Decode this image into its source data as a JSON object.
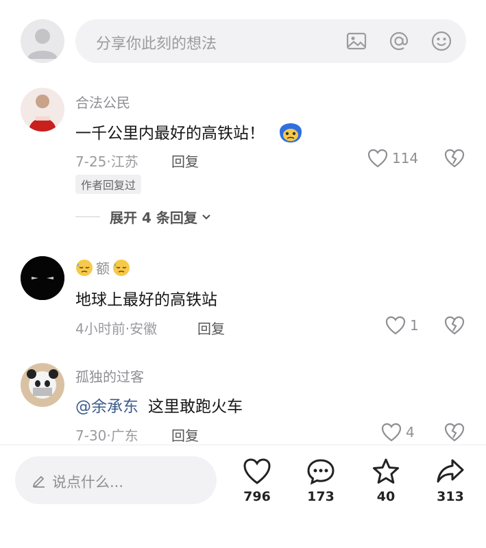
{
  "composer": {
    "placeholder": "分享你此刻的想法"
  },
  "comments": [
    {
      "name": "合法公民",
      "text": "一千公里内最好的高铁站！",
      "date_location": "7-25·江苏",
      "reply_label": "回复",
      "likes": "114",
      "author_badge": "作者回复过",
      "expand_label": "展开 4 条回复"
    },
    {
      "name": "额",
      "text": "地球上最好的高铁站",
      "date_location": "4小时前·安徽",
      "reply_label": "回复",
      "likes": "1"
    },
    {
      "name": "孤独的过客",
      "mention": "@余承东",
      "text": "这里敢跑火车",
      "date_location": "7-30·广东",
      "reply_label": "回复",
      "likes": "4"
    }
  ],
  "bottom_bar": {
    "input_placeholder": "说点什么...",
    "like_count": "796",
    "comment_count": "173",
    "favorite_count": "40",
    "share_count": "313"
  },
  "colors": {
    "accent_mention": "#3b5a8c",
    "muted": "#8e8e93"
  }
}
